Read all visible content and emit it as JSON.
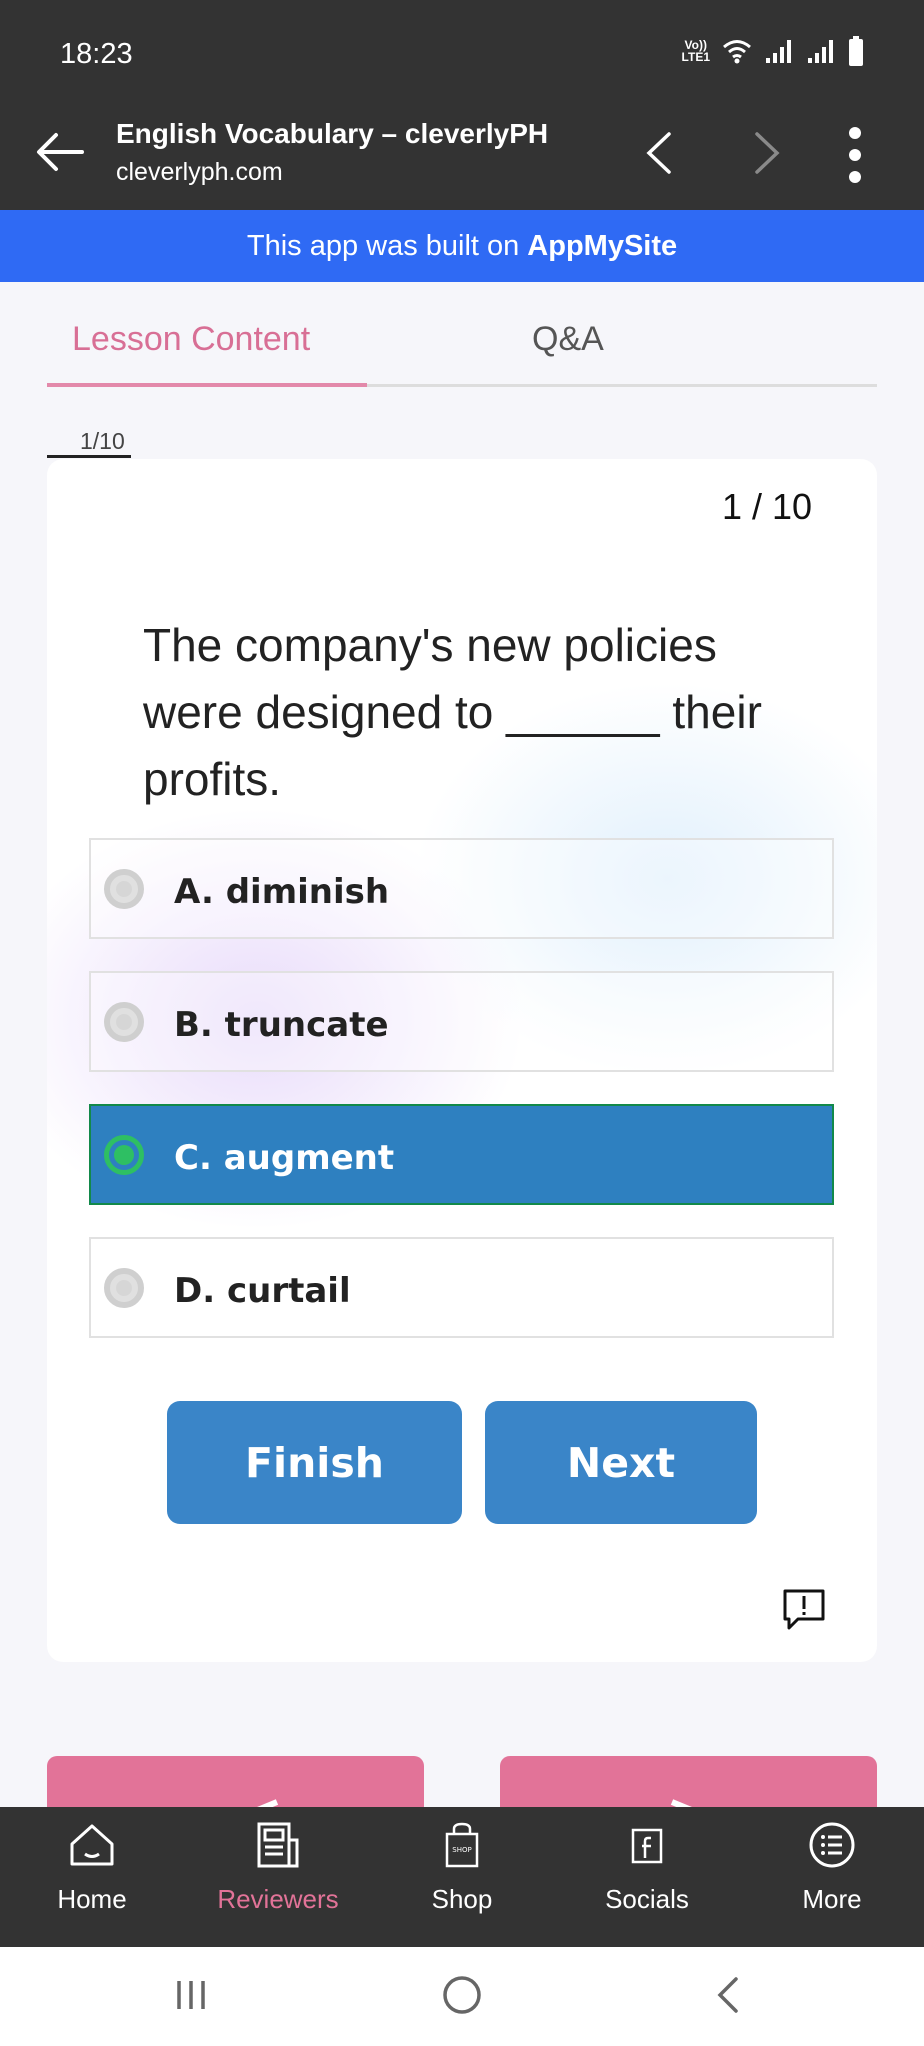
{
  "status_bar": {
    "time": "18:23",
    "volte_label": "Vo)) LTE1"
  },
  "header": {
    "title": "English Vocabulary – cleverlyPH",
    "url": "cleverlyph.com"
  },
  "banner": {
    "prefix": "This app was built on",
    "brand": "AppMySite",
    "color": "#2f6af4"
  },
  "tabs": [
    {
      "label": "Lesson Content",
      "active": true
    },
    {
      "label": "Q&A",
      "active": false
    }
  ],
  "progress": {
    "label": "1/10",
    "fraction": 0.1
  },
  "quiz": {
    "counter": "1 / 10",
    "question": "The company's new policies were designed to ______ their profits.",
    "options": [
      {
        "label": "A. diminish",
        "selected": false
      },
      {
        "label": "B. truncate",
        "selected": false
      },
      {
        "label": "C. augment",
        "selected": true
      },
      {
        "label": "D. curtail",
        "selected": false
      }
    ],
    "finish_label": "Finish",
    "next_label": "Next"
  },
  "bottom_nav": {
    "items": [
      {
        "label": "Home",
        "icon": "home-icon",
        "active": false
      },
      {
        "label": "Reviewers",
        "icon": "newspaper-icon",
        "active": true
      },
      {
        "label": "Shop",
        "icon": "shop-bag-icon",
        "active": false
      },
      {
        "label": "Socials",
        "icon": "facebook-icon",
        "active": false
      },
      {
        "label": "More",
        "icon": "list-icon",
        "active": false
      }
    ]
  },
  "colors": {
    "accent_pink": "#e27398",
    "selected_option": "#2e80c0",
    "button_blue": "#3a85c8",
    "dark_bar": "#333333"
  }
}
